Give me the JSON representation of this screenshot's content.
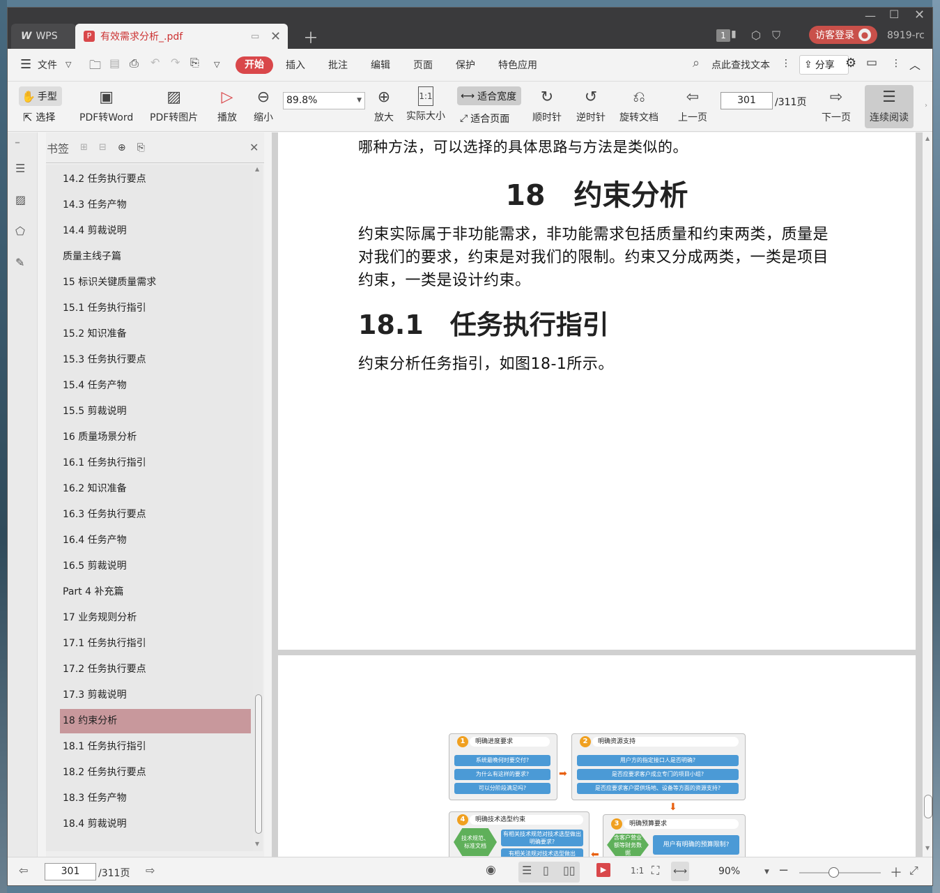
{
  "titlebar": {
    "wps_tab": "WPS",
    "doc_tab": "有效需求分析_.pdf",
    "badge": "1",
    "login": "访客登录",
    "user_id": "8919-rc"
  },
  "menu": {
    "file": "文件",
    "items": [
      "开始",
      "插入",
      "批注",
      "编辑",
      "页面",
      "保护",
      "特色应用"
    ],
    "search": "点此查找文本",
    "share": "分享"
  },
  "toolbar": {
    "hand": "手型",
    "select": "选择",
    "pdf_word": "PDF转Word",
    "pdf_img": "PDF转图片",
    "play": "播放",
    "zoom_out": "缩小",
    "zoom_value": "89.8%",
    "zoom_in": "放大",
    "actual_size": "实际大小",
    "fit_width": "适合宽度",
    "fit_page": "适合页面",
    "cw": "顺时针",
    "ccw": "逆时针",
    "rotate": "旋转文档",
    "prev": "上一页",
    "page": "301",
    "total": "/311页",
    "next": "下一页",
    "continuous": "连续阅读"
  },
  "bookmarks": {
    "title": "书签",
    "items": [
      "14.2 任务执行要点",
      "14.3 任务产物",
      "14.4 剪裁说明",
      "质量主线子篇",
      "15 标识关键质量需求",
      "15.1 任务执行指引",
      "15.2 知识准备",
      "15.3 任务执行要点",
      "15.4 任务产物",
      "15.5 剪裁说明",
      "16 质量场景分析",
      "16.1 任务执行指引",
      "16.2 知识准备",
      "16.3 任务执行要点",
      "16.4 任务产物",
      "16.5 剪裁说明",
      "Part 4 补充篇",
      "17 业务规则分析",
      "17.1 任务执行指引",
      "17.2 任务执行要点",
      "17.3 剪裁说明",
      "18 约束分析",
      "18.1 任务执行指引",
      "18.2 任务执行要点",
      "18.3 任务产物",
      "18.4 剪裁说明"
    ],
    "active_index": 21
  },
  "document": {
    "line0": "哪种方法，可以选择的具体思路与方法是类似的。",
    "heading": "18　约束分析",
    "para1_l1": "约束实际属于非功能需求，非功能需求包括质量和约束两类，质量是",
    "para1_l2": "对我们的要求，约束是对我们的限制。约束又分成两类，一类是项目",
    "para1_l3": "约束，一类是设计约束。",
    "heading2": "18.1　任务执行指引",
    "para2": "约束分析任务指引，如图18-1所示。",
    "diagram": {
      "b1_title": "明确进度要求",
      "b1_items": [
        "系统最晚何时要交付?",
        "为什么有这样的要求?",
        "可以分阶段满足吗?"
      ],
      "b2_title": "明确资源支持",
      "b2_items": [
        "用户方的指定接口人是否明确?",
        "是否应要求客户成立专门的项目小组?",
        "是否应要求客户提供场地、设备等方面的资源支持?"
      ],
      "b3_title": "明确预算要求",
      "b3_hex": "含客户营业额等财务数据",
      "b3_item": "用户有明确的预算限制?",
      "b4_title": "明确技术选型约束",
      "b4_hex": "技术规范、标准文档",
      "b4_items": [
        "有相关技术规范对技术选型做出明确要求?",
        "有相关法规对技术选型做出"
      ]
    }
  },
  "status": {
    "page": "301",
    "total": "/311页",
    "zoom": "90%"
  }
}
